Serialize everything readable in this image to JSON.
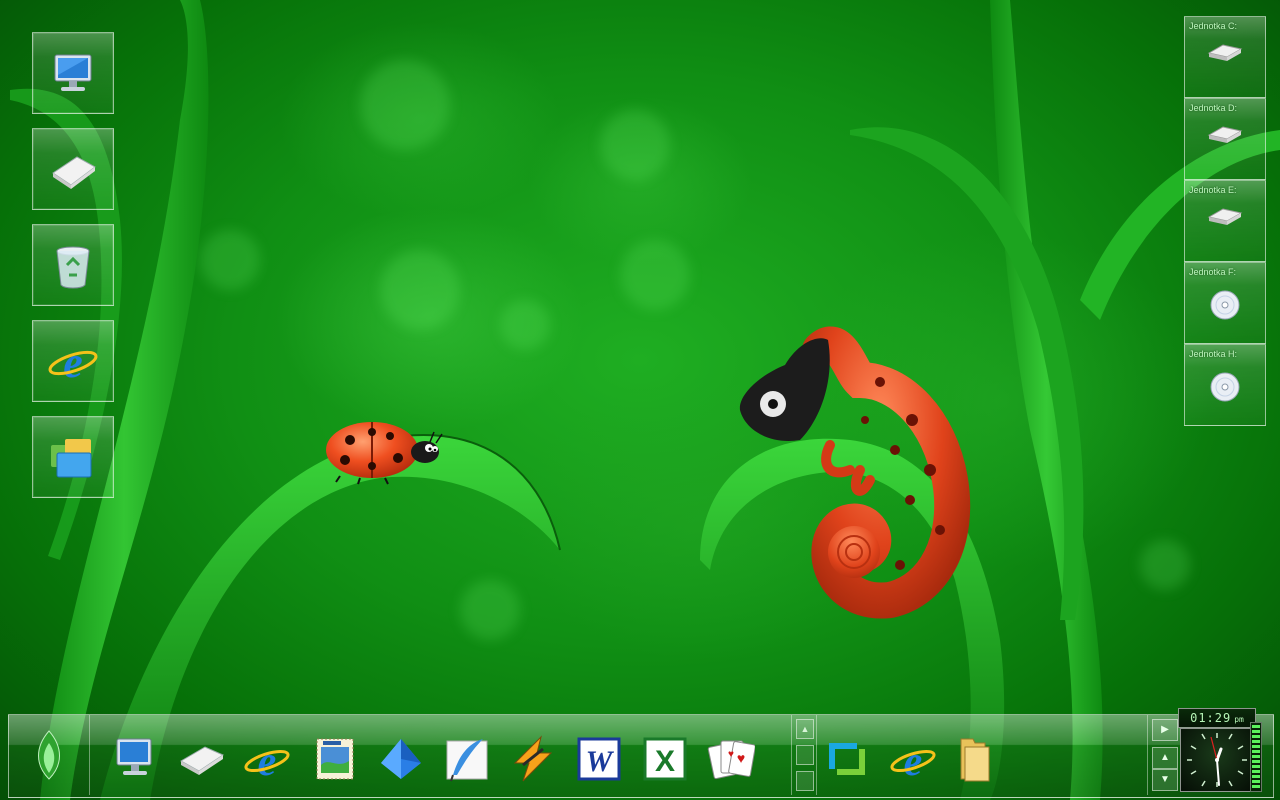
{
  "desktop": {
    "left_icons": [
      {
        "name": "my-computer"
      },
      {
        "name": "removable-disk"
      },
      {
        "name": "recycle-bin"
      },
      {
        "name": "internet-explorer"
      },
      {
        "name": "control-panel"
      }
    ],
    "drives": [
      {
        "label": "Jednotka C:",
        "kind": "hdd"
      },
      {
        "label": "Jednotka D:",
        "kind": "hdd"
      },
      {
        "label": "Jednotka E:",
        "kind": "hdd"
      },
      {
        "label": "Jednotka F:",
        "kind": "cd"
      },
      {
        "label": "Jednotka H:",
        "kind": "cd"
      }
    ]
  },
  "taskbar": {
    "dock_icons": [
      "computer-icon",
      "drive-icon",
      "internet-explorer-icon",
      "mail-stamp-icon",
      "blue-diamond-icon",
      "feather-quill-icon",
      "winamp-icon",
      "word-icon",
      "excel-icon",
      "solitaire-cards-icon"
    ],
    "quick_icons": [
      "media-player-icon",
      "internet-explorer-icon",
      "folder-icon"
    ],
    "clock": {
      "time": "01:29",
      "ampm": "pm"
    }
  },
  "colors": {
    "accent": "#1fae22",
    "ladybug": "#e8401c",
    "chameleon": "#e2461e"
  }
}
